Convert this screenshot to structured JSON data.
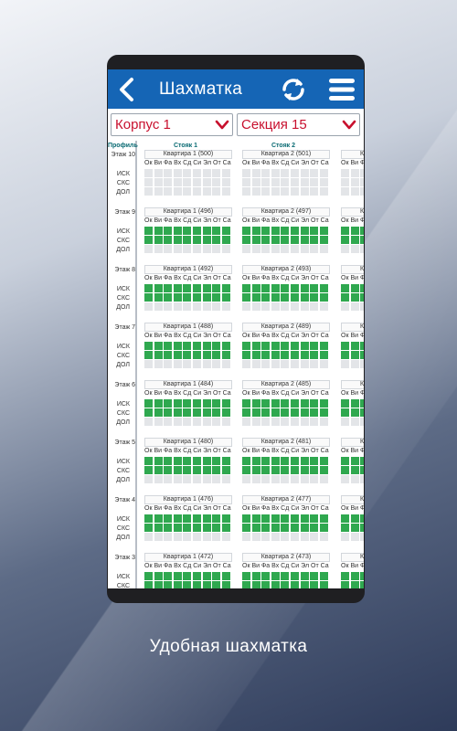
{
  "app": {
    "title": "Шахматка",
    "caption": "Удобная шахматка"
  },
  "selectors": {
    "building": "Корпус 1",
    "section": "Секция 15"
  },
  "grid": {
    "profile_header": "Профиль",
    "risers": [
      "Стояк 1",
      "Стояк 2"
    ],
    "days": "Ок Ви Фа Вх Сд Си Эл От Са",
    "days_partial": "Ок Ви Ф",
    "row_labels": [
      "ИСК",
      "СКС",
      "ДОЛ"
    ],
    "floors": [
      {
        "label": "Этаж 10",
        "apts": [
          "Квартира 1 (500)",
          "Квартира 2 (501)"
        ],
        "partial": "Кв",
        "filled": false
      },
      {
        "label": "Этаж 9",
        "apts": [
          "Квартира 1 (496)",
          "Квартира 2 (497)"
        ],
        "partial": "Кв",
        "filled": true
      },
      {
        "label": "Этаж 8",
        "apts": [
          "Квартира 1 (492)",
          "Квартира 2 (493)"
        ],
        "partial": "Кв",
        "filled": true
      },
      {
        "label": "Этаж 7",
        "apts": [
          "Квартира 1 (488)",
          "Квартира 2 (489)"
        ],
        "partial": "Кв",
        "filled": true
      },
      {
        "label": "Этаж 6",
        "apts": [
          "Квартира 1 (484)",
          "Квартира 2 (485)"
        ],
        "partial": "Кв",
        "filled": true
      },
      {
        "label": "Этаж 5",
        "apts": [
          "Квартира 1 (480)",
          "Квартира 2 (481)"
        ],
        "partial": "Кв",
        "filled": true
      },
      {
        "label": "Этаж 4",
        "apts": [
          "Квартира 1 (476)",
          "Квартира 2 (477)"
        ],
        "partial": "Кв",
        "filled": true
      },
      {
        "label": "Этаж 3",
        "apts": [
          "Квартира 1 (472)",
          "Квартира 2 (473)"
        ],
        "partial": "Кв",
        "filled": true
      }
    ]
  },
  "colors": {
    "appbar": "#1565b5",
    "accent_red": "#c8102e",
    "cell_on": "#2fa84f",
    "cell_off": "#e3e5e8"
  },
  "icons": {
    "back": "back-arrow-icon",
    "refresh": "refresh-icon",
    "menu": "hamburger-menu-icon",
    "dropdown": "chevron-down-icon"
  }
}
